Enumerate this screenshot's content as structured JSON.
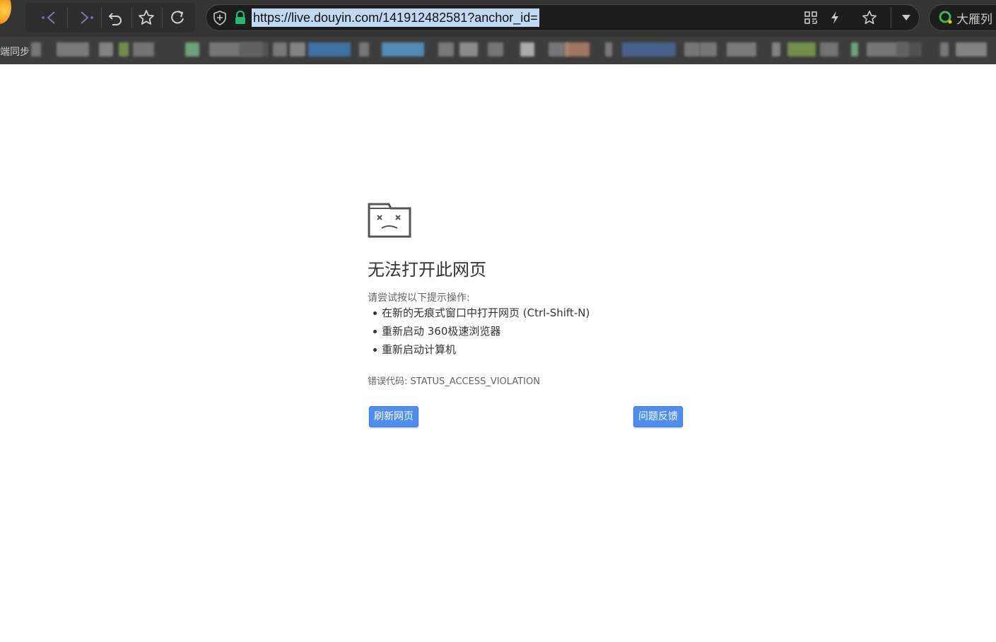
{
  "toolbar": {
    "url": "https://live.douyin.com/141912482581?anchor_id=",
    "search_text": "大雁列",
    "icons": [
      "back-icon",
      "forward-icon",
      "undo-icon",
      "star-icon",
      "reload-icon",
      "shield-icon",
      "lock-icon",
      "qr-code-icon",
      "lightning-icon",
      "favorite-icon",
      "dropdown-icon",
      "search-engine-icon"
    ],
    "colors": {
      "lock": "#2bb673",
      "url_highlight": "#c2d9f3",
      "search_ring": "#3cb84a"
    }
  },
  "bookmarks": {
    "sync_label": "端同步",
    "blurred_items": [
      {
        "color": "#8a8a8a"
      },
      {
        "color": "#8f8f8f"
      },
      {
        "color": "#9a9a9a"
      },
      {
        "color": "#85a94d"
      },
      {
        "color": "#858585"
      },
      {
        "color": "#7fc38e"
      },
      {
        "color": "#8a8a8a"
      },
      {
        "color": "#5a5a5a"
      },
      {
        "color": "#8c8c8c"
      },
      {
        "color": "#9b9b9b"
      },
      {
        "color": "#3d84c4"
      },
      {
        "color": "#8a8a8a"
      },
      {
        "color": "#5aa6e0"
      },
      {
        "color": "#8c8c8c"
      },
      {
        "color": "#a5a5a5"
      },
      {
        "color": "#888888"
      },
      {
        "color": "#d0d0d0"
      },
      {
        "color": "#8a8a8a"
      },
      {
        "color": "#c08a70"
      },
      {
        "color": "#8f8f8f"
      },
      {
        "color": "#4a6fa5"
      },
      {
        "color": "#8a8a8a"
      }
    ]
  },
  "error": {
    "title": "无法打开此网页",
    "hint": "请尝试按以下提示操作:",
    "suggestions": [
      "在新的无痕式窗口中打开网页 (Ctrl-Shift-N)",
      "重新启动 360极速浏览器",
      "重新启动计算机"
    ],
    "code": "错误代码:  STATUS_ACCESS_VIOLATION",
    "reload_label": "刷新网页",
    "feedback_label": "问题反馈",
    "button_color": "#4d8ef0"
  }
}
